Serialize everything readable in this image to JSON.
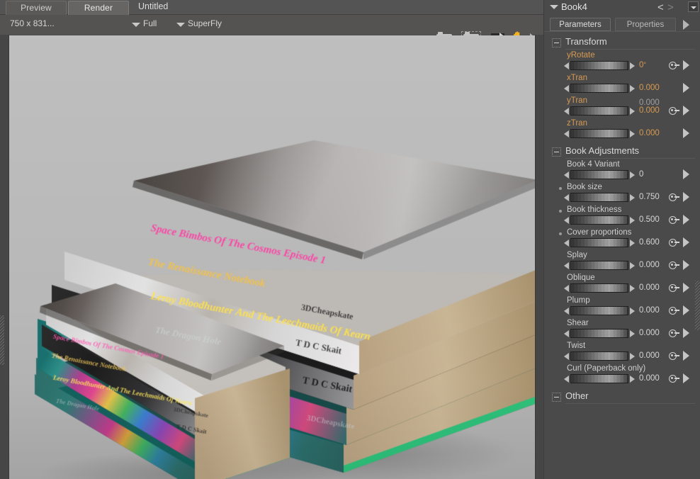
{
  "render_pane": {
    "tabs": [
      {
        "label": "Preview",
        "active": false
      },
      {
        "label": "Render",
        "active": true
      }
    ],
    "document_title": "Untitled",
    "options_bar": {
      "resolution": "750 x 831...",
      "quality": "Full",
      "engine": "SuperFly"
    },
    "toolbar_icons": [
      "camera-icon",
      "camera-area-icon",
      "export-arrow-icon",
      "hand-pan-icon",
      "more-arrow-icon"
    ],
    "viewport": {
      "background_color": "#b9b9b9",
      "scene_description": "Two stacks of rendered 3D books on a light grey backdrop",
      "book_titles": [
        "Space Bimbos Of The Cosmos Episode 1",
        "The Renaissance Notebook",
        "Leroy Bloodhunter And The Leechmaids Of Kearn",
        "The Dragon Hole"
      ],
      "imprint": "3DCheapskate",
      "author_mark": "T D C Skait"
    }
  },
  "param_panel": {
    "title": "Book4",
    "nav_prev": "<",
    "nav_next": ">",
    "tabs": [
      {
        "label": "Parameters",
        "active": true
      },
      {
        "label": "Properties",
        "active": false
      }
    ],
    "groups": [
      {
        "name": "Transform",
        "collapsed": false,
        "rows": [
          {
            "label": "yRotate",
            "label_style": "orange",
            "value": "0",
            "unit": "°",
            "value_style": "orange",
            "has_key": true,
            "has_dot": false
          },
          {
            "label": "xTran",
            "label_style": "orange",
            "value": "0.000",
            "unit": "",
            "value_style": "orange",
            "has_key": false,
            "has_dot": false
          },
          {
            "label": "yTran",
            "label_style": "orange",
            "value": "0.000",
            "unit": "",
            "value_style": "orange",
            "has_key": true,
            "has_dot": false,
            "ghost_value": "0.000"
          },
          {
            "label": "zTran",
            "label_style": "orange",
            "value": "0.000",
            "unit": "",
            "value_style": "orange",
            "has_key": false,
            "has_dot": false
          }
        ]
      },
      {
        "name": "Book Adjustments",
        "collapsed": false,
        "rows": [
          {
            "label": "Book 4 Variant",
            "label_style": "plain",
            "value": "0",
            "unit": "",
            "value_style": "plain",
            "has_key": false,
            "has_dot": false
          },
          {
            "label": "Book size",
            "label_style": "plain",
            "value": "0.750",
            "unit": "",
            "value_style": "plain",
            "has_key": true,
            "has_dot": true
          },
          {
            "label": "Book thickness",
            "label_style": "plain",
            "value": "0.500",
            "unit": "",
            "value_style": "plain",
            "has_key": true,
            "has_dot": true
          },
          {
            "label": "Cover proportions",
            "label_style": "plain",
            "value": "0.600",
            "unit": "",
            "value_style": "plain",
            "has_key": true,
            "has_dot": true
          },
          {
            "label": "Splay",
            "label_style": "plain",
            "value": "0.000",
            "unit": "",
            "value_style": "plain",
            "has_key": true,
            "has_dot": false
          },
          {
            "label": "Oblique",
            "label_style": "plain",
            "value": "0.000",
            "unit": "",
            "value_style": "plain",
            "has_key": true,
            "has_dot": false
          },
          {
            "label": "Plump",
            "label_style": "plain",
            "value": "0.000",
            "unit": "",
            "value_style": "plain",
            "has_key": true,
            "has_dot": false
          },
          {
            "label": "Shear",
            "label_style": "plain",
            "value": "0.000",
            "unit": "",
            "value_style": "plain",
            "has_key": true,
            "has_dot": false
          },
          {
            "label": "Twist",
            "label_style": "plain",
            "value": "0.000",
            "unit": "",
            "value_style": "plain",
            "has_key": true,
            "has_dot": false
          },
          {
            "label": "Curl (Paperback only)",
            "label_style": "plain",
            "value": "0.000",
            "unit": "",
            "value_style": "plain",
            "has_key": true,
            "has_dot": false
          }
        ]
      },
      {
        "name": "Other",
        "collapsed": false,
        "rows": []
      }
    ]
  },
  "colors": {
    "window_bg": "#4c4c4c",
    "panel_bg": "#4a4a4a",
    "toolbar_bg": "#545352",
    "accent_orange": "#d79a52",
    "text_light": "#d9d9d9",
    "viewport_bg": "#b9b9b9"
  }
}
